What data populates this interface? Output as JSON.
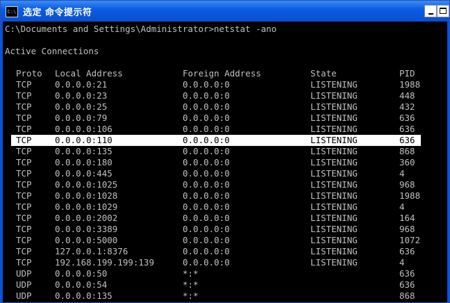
{
  "window": {
    "title": "选定 命令提示符",
    "icon_label": "C:\\"
  },
  "console": {
    "command_line": "C:\\Documents and Settings\\Administrator>netstat -ano",
    "section_header": "Active Connections",
    "columns": [
      "Proto",
      "Local Address",
      "Foreign Address",
      "State",
      "PID"
    ],
    "rows": [
      [
        "TCP",
        "0.0.0.0:21",
        "0.0.0.0:0",
        "LISTENING",
        "1988"
      ],
      [
        "TCP",
        "0.0.0.0:23",
        "0.0.0.0:0",
        "LISTENING",
        "448"
      ],
      [
        "TCP",
        "0.0.0.0:25",
        "0.0.0.0:0",
        "LISTENING",
        "432"
      ],
      [
        "TCP",
        "0.0.0.0:79",
        "0.0.0.0:0",
        "LISTENING",
        "636"
      ],
      [
        "TCP",
        "0.0.0.0:106",
        "0.0.0.0:0",
        "LISTENING",
        "636"
      ],
      [
        "TCP",
        "0.0.0.0:110",
        "0.0.0.0:0",
        "LISTENING",
        "636"
      ],
      [
        "TCP",
        "0.0.0.0:135",
        "0.0.0.0:0",
        "LISTENING",
        "868"
      ],
      [
        "TCP",
        "0.0.0.0:180",
        "0.0.0.0:0",
        "LISTENING",
        "360"
      ],
      [
        "TCP",
        "0.0.0.0:445",
        "0.0.0.0:0",
        "LISTENING",
        "4"
      ],
      [
        "TCP",
        "0.0.0.0:1025",
        "0.0.0.0:0",
        "LISTENING",
        "968"
      ],
      [
        "TCP",
        "0.0.0.0:1028",
        "0.0.0.0:0",
        "LISTENING",
        "1988"
      ],
      [
        "TCP",
        "0.0.0.0:1029",
        "0.0.0.0:0",
        "LISTENING",
        "4"
      ],
      [
        "TCP",
        "0.0.0.0:2002",
        "0.0.0.0:0",
        "LISTENING",
        "164"
      ],
      [
        "TCP",
        "0.0.0.0:3389",
        "0.0.0.0:0",
        "LISTENING",
        "968"
      ],
      [
        "TCP",
        "0.0.0.0:5000",
        "0.0.0.0:0",
        "LISTENING",
        "1072"
      ],
      [
        "TCP",
        "127.0.0.1:8376",
        "0.0.0.0:0",
        "LISTENING",
        "636"
      ],
      [
        "TCP",
        "192.168.199.199:139",
        "0.0.0.0:0",
        "LISTENING",
        "4"
      ],
      [
        "UDP",
        "0.0.0.0:50",
        "*:*",
        "",
        "636"
      ],
      [
        "UDP",
        "0.0.0.0:54",
        "*:*",
        "",
        "636"
      ],
      [
        "UDP",
        "0.0.0.0:135",
        "*:*",
        "",
        "868"
      ]
    ],
    "selected_row": 5
  },
  "icons": {
    "window_icon": "console-icon",
    "minimize": "minimize-icon",
    "maximize": "maximize-icon",
    "mouse_cursor": "text-cursor-icon"
  },
  "colors": {
    "titlebar": "#0a4fd0",
    "console_background": "#000000",
    "console_text": "#c0c0c0",
    "selection_background": "#ffffff",
    "selection_text": "#000000"
  }
}
